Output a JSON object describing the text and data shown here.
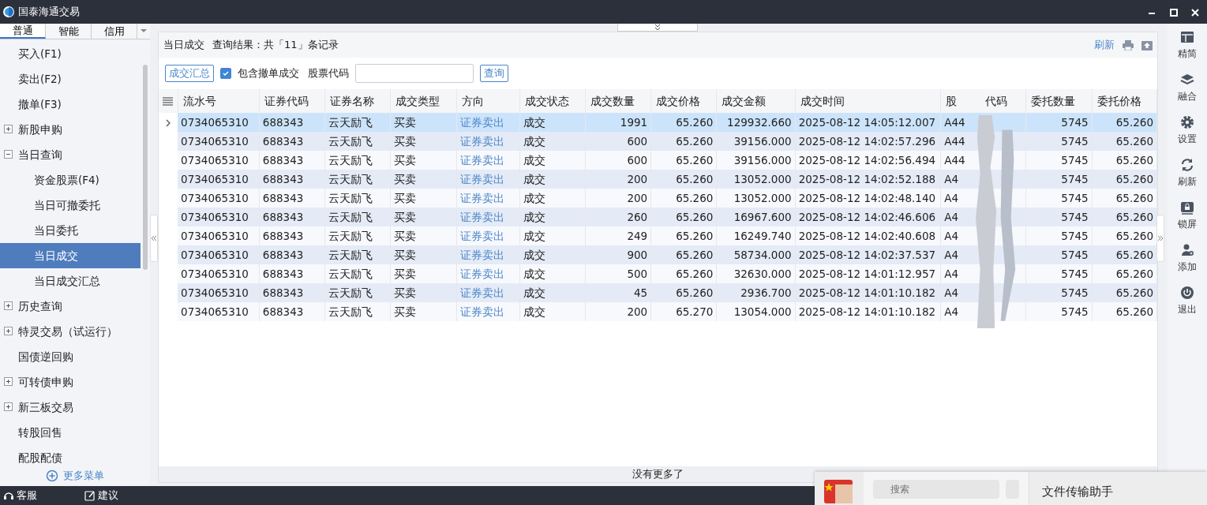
{
  "window": {
    "title": "国泰海通交易"
  },
  "sidebar": {
    "tabs": [
      {
        "label": "普通",
        "selected": true
      },
      {
        "label": "智能",
        "selected": false
      },
      {
        "label": "信用",
        "selected": false
      }
    ],
    "items": [
      {
        "kind": "item",
        "label": "买入(F1)",
        "selected": false
      },
      {
        "kind": "item",
        "label": "卖出(F2)",
        "selected": false
      },
      {
        "kind": "item",
        "label": "撤单(F3)",
        "selected": false
      },
      {
        "kind": "group",
        "label": "新股申购",
        "selected": false,
        "expanded": false
      },
      {
        "kind": "group",
        "label": "当日查询",
        "selected": false,
        "expanded": true,
        "children": [
          {
            "label": "资金股票(F4)",
            "selected": false
          },
          {
            "label": "当日可撤委托",
            "selected": false
          },
          {
            "label": "当日委托",
            "selected": false
          },
          {
            "label": "当日成交",
            "selected": true
          },
          {
            "label": "当日成交汇总",
            "selected": false
          }
        ]
      },
      {
        "kind": "group",
        "label": "历史查询",
        "selected": false,
        "expanded": false
      },
      {
        "kind": "group",
        "label": "特灵交易（试运行）",
        "selected": false,
        "expanded": false
      },
      {
        "kind": "item",
        "label": "国债逆回购",
        "selected": false
      },
      {
        "kind": "group",
        "label": "可转债申购",
        "selected": false,
        "expanded": false
      },
      {
        "kind": "group",
        "label": "新三板交易",
        "selected": false,
        "expanded": false
      },
      {
        "kind": "item",
        "label": "转股回售",
        "selected": false
      },
      {
        "kind": "item",
        "label": "配股配债",
        "selected": false
      }
    ],
    "more": "更多菜单"
  },
  "panel": {
    "title": "当日成交",
    "result": "查询结果：共「11」条记录",
    "refresh": "刷新"
  },
  "toolbar": {
    "summary_button": "成交汇总",
    "checkbox": {
      "label": "包含撤单成交",
      "checked": true
    },
    "code_label": "股票代码",
    "query_button": "查询"
  },
  "table": {
    "columns": [
      "流水号",
      "证券代码",
      "证券名称",
      "成交类型",
      "方向",
      "成交状态",
      "成交数量",
      "成交价格",
      "成交金额",
      "成交时间",
      [
        "股",
        "代码"
      ],
      "委托数量",
      "委托价格"
    ],
    "rows": [
      {
        "selected": true,
        "cells": [
          "0734065310",
          "688343",
          "云天励飞",
          "买卖",
          "证券卖出",
          "成交",
          "1991",
          "65.260",
          "129932.660",
          "2025-08-12 14:05:12.007",
          "A44",
          "5745",
          "65.260"
        ]
      },
      {
        "selected": false,
        "cells": [
          "0734065310",
          "688343",
          "云天励飞",
          "买卖",
          "证券卖出",
          "成交",
          "600",
          "65.260",
          "39156.000",
          "2025-08-12 14:02:57.296",
          "A44",
          "5745",
          "65.260"
        ]
      },
      {
        "selected": false,
        "cells": [
          "0734065310",
          "688343",
          "云天励飞",
          "买卖",
          "证券卖出",
          "成交",
          "600",
          "65.260",
          "39156.000",
          "2025-08-12 14:02:56.494",
          "A44",
          "5745",
          "65.260"
        ]
      },
      {
        "selected": false,
        "cells": [
          "0734065310",
          "688343",
          "云天励飞",
          "买卖",
          "证券卖出",
          "成交",
          "200",
          "65.260",
          "13052.000",
          "2025-08-12 14:02:52.188",
          "A4",
          "5745",
          "65.260"
        ]
      },
      {
        "selected": false,
        "cells": [
          "0734065310",
          "688343",
          "云天励飞",
          "买卖",
          "证券卖出",
          "成交",
          "200",
          "65.260",
          "13052.000",
          "2025-08-12 14:02:48.140",
          "A4",
          "5745",
          "65.260"
        ]
      },
      {
        "selected": false,
        "cells": [
          "0734065310",
          "688343",
          "云天励飞",
          "买卖",
          "证券卖出",
          "成交",
          "260",
          "65.260",
          "16967.600",
          "2025-08-12 14:02:46.606",
          "A4",
          "5745",
          "65.260"
        ]
      },
      {
        "selected": false,
        "cells": [
          "0734065310",
          "688343",
          "云天励飞",
          "买卖",
          "证券卖出",
          "成交",
          "249",
          "65.260",
          "16249.740",
          "2025-08-12 14:02:40.608",
          "A4",
          "5745",
          "65.260"
        ]
      },
      {
        "selected": false,
        "cells": [
          "0734065310",
          "688343",
          "云天励飞",
          "买卖",
          "证券卖出",
          "成交",
          "900",
          "65.260",
          "58734.000",
          "2025-08-12 14:02:37.537",
          "A4",
          "5745",
          "65.260"
        ]
      },
      {
        "selected": false,
        "cells": [
          "0734065310",
          "688343",
          "云天励飞",
          "买卖",
          "证券卖出",
          "成交",
          "500",
          "65.260",
          "32630.000",
          "2025-08-12 14:01:12.957",
          "A4",
          "5745",
          "65.260"
        ]
      },
      {
        "selected": false,
        "cells": [
          "0734065310",
          "688343",
          "云天励飞",
          "买卖",
          "证券卖出",
          "成交",
          "45",
          "65.260",
          "2936.700",
          "2025-08-12 14:01:10.182",
          "A4",
          "5745",
          "65.260"
        ]
      },
      {
        "selected": false,
        "cells": [
          "0734065310",
          "688343",
          "云天励飞",
          "买卖",
          "证券卖出",
          "成交",
          "200",
          "65.270",
          "13054.000",
          "2025-08-12 14:01:10.182",
          "A4",
          "5745",
          "65.260"
        ]
      }
    ],
    "footer": "没有更多了"
  },
  "right_toolbar": [
    {
      "kind": "layout",
      "label": "精简"
    },
    {
      "kind": "layers",
      "label": "融合"
    },
    {
      "kind": "gear",
      "label": "设置"
    },
    {
      "kind": "refresh",
      "label": "刷新"
    },
    {
      "kind": "lock",
      "label": "锁屏"
    },
    {
      "kind": "user",
      "label": "添加"
    },
    {
      "kind": "power",
      "label": "退出"
    }
  ],
  "status_bar": [
    {
      "kind": "headset",
      "label": "客服"
    },
    {
      "kind": "edit",
      "label": "建议"
    }
  ],
  "chat_window": {
    "search_placeholder": "搜索",
    "title": "文件传输助手"
  }
}
